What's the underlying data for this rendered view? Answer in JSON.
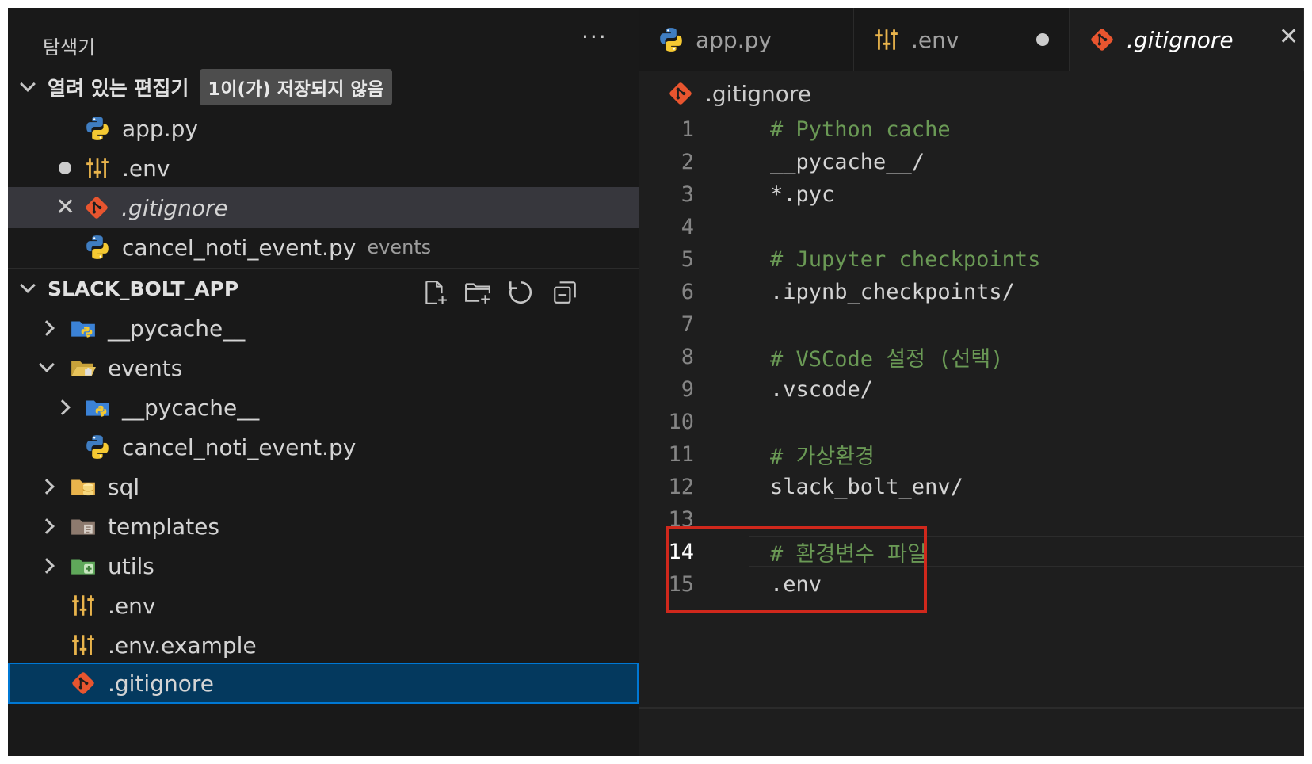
{
  "explorer": {
    "title": "탐색기",
    "more_label": "···",
    "open_editors": {
      "title": "열려 있는 편집기",
      "badge": "1이(가) 저장되지 않음",
      "items": [
        {
          "label": "app.py",
          "desc": "",
          "icon": "python-icon"
        },
        {
          "label": ".env",
          "desc": "",
          "icon": "settings-sliders-icon",
          "modified": true
        },
        {
          "label": ".gitignore",
          "desc": "",
          "icon": "git-icon",
          "active": true
        },
        {
          "label": "cancel_noti_event.py",
          "desc": "events",
          "icon": "python-icon"
        }
      ]
    },
    "project": {
      "title": "SLACK_BOLT_APP",
      "tree": [
        {
          "label": "__pycache__",
          "icon": "python-folder-icon"
        },
        {
          "label": "events",
          "icon": "folder-open-icon"
        },
        {
          "label": "__pycache__",
          "icon": "python-folder-icon"
        },
        {
          "label": "cancel_noti_event.py",
          "icon": "python-icon"
        },
        {
          "label": "sql",
          "icon": "database-folder-icon"
        },
        {
          "label": "templates",
          "icon": "templates-folder-icon"
        },
        {
          "label": "utils",
          "icon": "utils-folder-icon"
        },
        {
          "label": ".env",
          "icon": "settings-sliders-icon"
        },
        {
          "label": ".env.example",
          "icon": "settings-sliders-icon"
        },
        {
          "label": ".gitignore",
          "icon": "git-icon",
          "selected": true
        }
      ]
    }
  },
  "tabs": [
    {
      "label": "app.py",
      "icon": "python-icon"
    },
    {
      "label": ".env",
      "icon": "settings-sliders-icon",
      "modified": true
    },
    {
      "label": ".gitignore",
      "icon": "git-icon",
      "active": true
    }
  ],
  "breadcrumb": {
    "label": ".gitignore",
    "icon": "git-icon"
  },
  "code": {
    "current_line": 14,
    "lines": [
      {
        "n": "1",
        "text": "# Python cache",
        "kind": "comment"
      },
      {
        "n": "2",
        "text": "__pycache__/",
        "kind": "plain"
      },
      {
        "n": "3",
        "text": "*.pyc",
        "kind": "plain"
      },
      {
        "n": "4",
        "text": "",
        "kind": "plain"
      },
      {
        "n": "5",
        "text": "# Jupyter checkpoints",
        "kind": "comment"
      },
      {
        "n": "6",
        "text": ".ipynb_checkpoints/",
        "kind": "plain"
      },
      {
        "n": "7",
        "text": "",
        "kind": "plain"
      },
      {
        "n": "8",
        "text": "# VSCode 설정 (선택)",
        "kind": "comment"
      },
      {
        "n": "9",
        "text": ".vscode/",
        "kind": "plain"
      },
      {
        "n": "10",
        "text": "",
        "kind": "plain"
      },
      {
        "n": "11",
        "text": "# 가상환경",
        "kind": "comment"
      },
      {
        "n": "12",
        "text": "slack_bolt_env/",
        "kind": "plain"
      },
      {
        "n": "13",
        "text": "",
        "kind": "plain"
      },
      {
        "n": "14",
        "text": "# 환경변수 파일",
        "kind": "comment"
      },
      {
        "n": "15",
        "text": ".env",
        "kind": "plain"
      }
    ]
  },
  "colors": {
    "accent": "#0078d4",
    "highlight_box": "#d0281c",
    "comment": "#6a9955",
    "git": "#e8552f",
    "python_blue": "#3f7dc1",
    "python_yellow": "#f5c932"
  }
}
